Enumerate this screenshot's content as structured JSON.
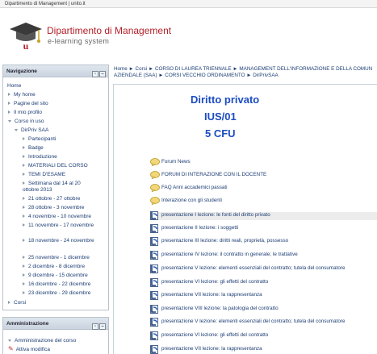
{
  "topbar": {
    "text": "Dipartimento di Management | unito.it"
  },
  "brand": {
    "title": "Dipartimento di Management",
    "subtitle": "e-learning system"
  },
  "navigation": {
    "title": "Navigazione",
    "home": "Home",
    "my_home": "My home",
    "site_pages": "Pagine del sito",
    "my_profile": "Il mio profilo",
    "current_course": "Corso in uso",
    "course_short": "DirPriv SAA",
    "items": [
      "Partecipanti",
      "Badge",
      "Introduzione",
      "MATERIALI DEL CORSO",
      "TEMI D'ESAME",
      "Settimana dal 14 al 20 ottobre 2013",
      "21 ottobre - 27 ottobre",
      "28 ottobre - 3 novembre",
      "4 novembre - 10 novembre",
      "11 novembre - 17 novembre",
      "18 novembre - 24 novembre",
      "25 novembre - 1 dicembre",
      "2 dicembre - 8 dicembre",
      "9 dicembre - 15 dicembre",
      "16 dicembre - 22 dicembre",
      "23 dicembre - 29 dicembre"
    ],
    "courses": "Corsi"
  },
  "administration": {
    "title": "Amministrazione",
    "course_admin": "Amministrazione del corso",
    "edit_on": "Attiva modifica"
  },
  "breadcrumb": {
    "line1": "Home ► Corsi ► CORSO DI LAUREA TRIENNALE ► MANAGEMENT DELL'INFORMAZIONE E DELLA COMUN",
    "line2": "AZIENDALE (SAA) ► CORSI VECCHIO ORDINAMENTO ► DirPrivSAA"
  },
  "course": {
    "title": "Diritto privato",
    "code": "IUS/01",
    "cfu": "5 CFU"
  },
  "activities": [
    {
      "type": "forum",
      "label": "Forum News"
    },
    {
      "type": "forum",
      "label": "FORUM DI INTERAZIONE CON IL DOCENTE"
    },
    {
      "type": "forum",
      "label": "FAQ Anni accademici passati"
    },
    {
      "type": "forum",
      "label": "Interazione con gli studenti"
    },
    {
      "type": "presentation",
      "label": "presentazione I lezione: le fonti del diritto privato"
    },
    {
      "type": "presentation",
      "label": "presentazione II lezione: i soggetti"
    },
    {
      "type": "presentation",
      "label": "presentazione III lezione: diritti reali, proprietà, possesso"
    },
    {
      "type": "presentation",
      "label": "presentazione IV lezione: il contratto in generale; le trattative"
    },
    {
      "type": "presentation",
      "label": "presentazione V lezione: elementi essenziali del contratto; tutela del consumatore"
    },
    {
      "type": "presentation",
      "label": "presentazione VI lezione: gli effetti del contratto"
    },
    {
      "type": "presentation",
      "label": "presentazione VII lezione: la rappresentanza"
    },
    {
      "type": "presentation",
      "label": "presentazione VIII lezione: la patologia del contratto"
    },
    {
      "type": "presentation",
      "label": "presentazione V lezione: elementi essenziali del contratto; tutela del consumatore"
    },
    {
      "type": "presentation",
      "label": "presentazione VI lezione: gli effetti del contratto"
    },
    {
      "type": "presentation",
      "label": "presentazione VII lezione: la rappresentanza"
    }
  ],
  "colors": {
    "brand_red": "#b3202a",
    "title_blue": "#1b4cc2",
    "link_blue": "#1b3c73"
  }
}
